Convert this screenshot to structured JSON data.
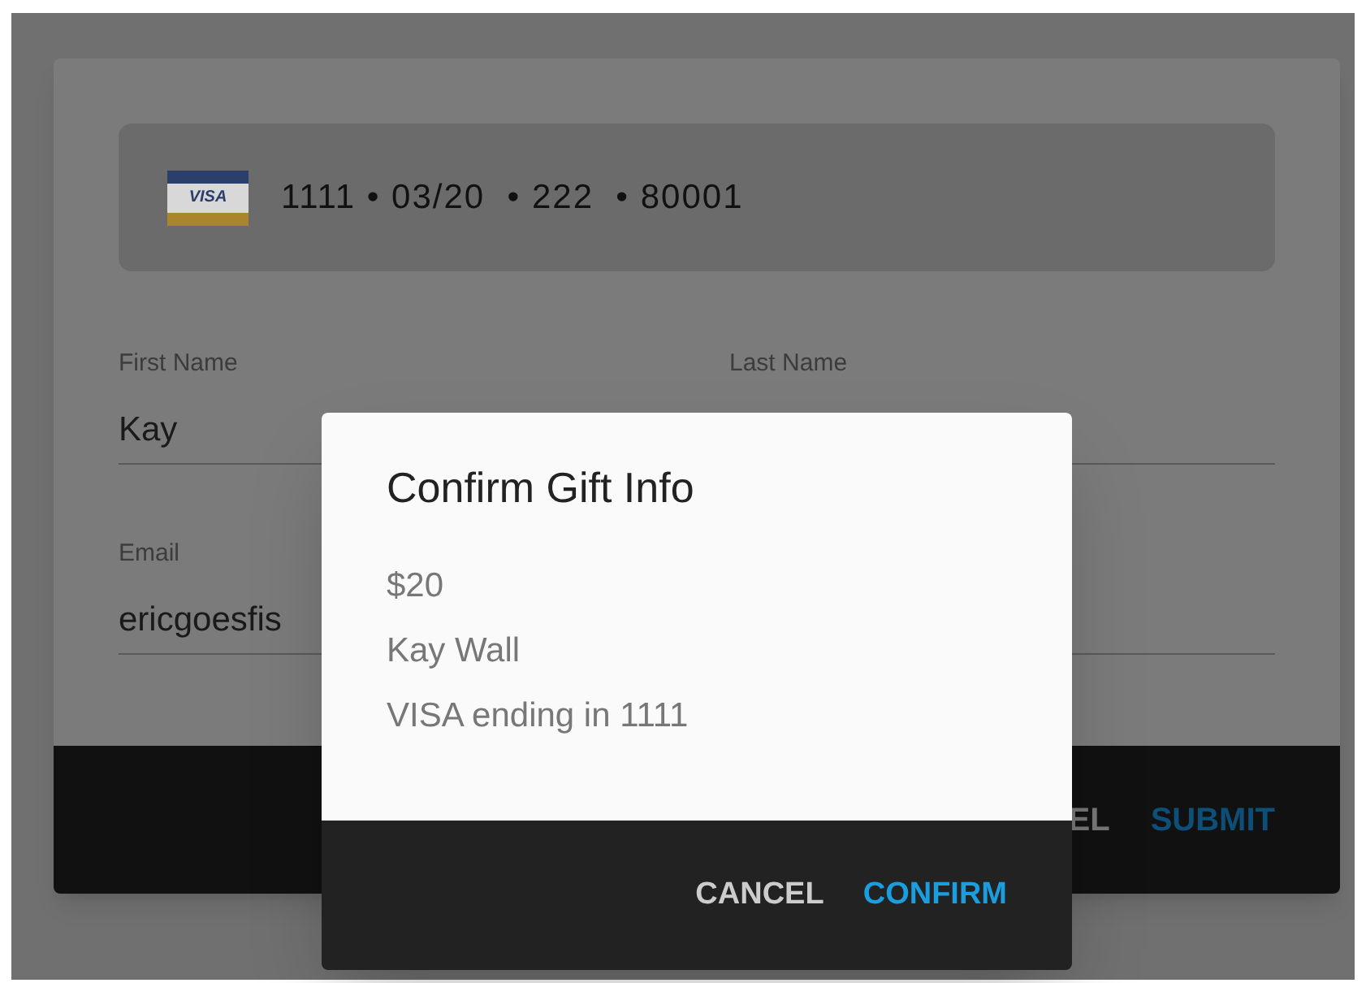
{
  "card": {
    "brand": "VISA",
    "summary": "1111 • 03/20  • 222  • 80001"
  },
  "fields": [
    {
      "label": "First Name",
      "value": "Kay"
    },
    {
      "label": "Last Name"
    },
    {
      "label": "Email",
      "value": "ericgoesfis"
    }
  ],
  "footer": {
    "cancel": "EL",
    "submit": "SUBMIT"
  },
  "dialog": {
    "title": "Confirm Gift Info",
    "lines": [
      "$20",
      "Kay Wall",
      "VISA ending in 1111"
    ],
    "cancel": "CANCEL",
    "confirm": "CONFIRM"
  }
}
